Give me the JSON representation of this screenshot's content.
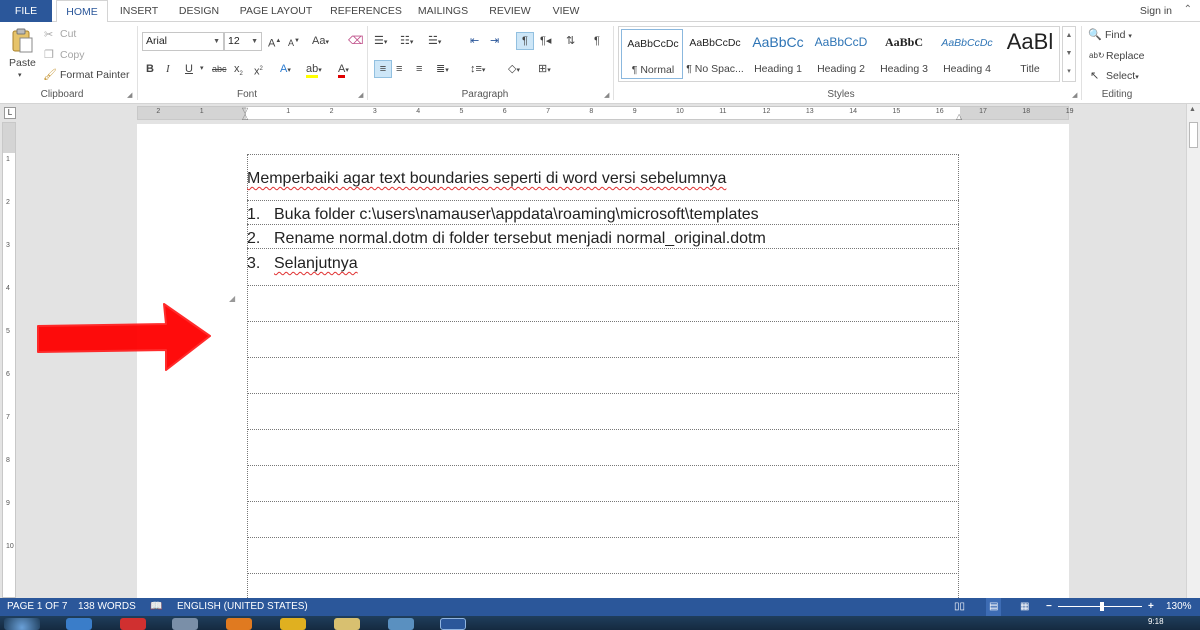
{
  "tabs": [
    "FILE",
    "HOME",
    "INSERT",
    "DESIGN",
    "PAGE LAYOUT",
    "REFERENCES",
    "MAILINGS",
    "REVIEW",
    "VIEW"
  ],
  "active_tab": "HOME",
  "signin": "Sign in",
  "clipboard": {
    "paste": "Paste",
    "cut": "Cut",
    "copy": "Copy",
    "format_painter": "Format Painter",
    "label": "Clipboard"
  },
  "font": {
    "name": "Arial",
    "size": "12",
    "case_label": "Aa",
    "label": "Font"
  },
  "paragraph": {
    "label": "Paragraph"
  },
  "styles": {
    "label": "Styles",
    "items": [
      {
        "preview": "AaBbCcDc",
        "name": "¶ Normal"
      },
      {
        "preview": "AaBbCcDc",
        "name": "¶ No Spac..."
      },
      {
        "preview": "AaBbCc",
        "name": "Heading 1"
      },
      {
        "preview": "AaBbCcD",
        "name": "Heading 2"
      },
      {
        "preview": "AaBbC",
        "name": "Heading 3"
      },
      {
        "preview": "AaBbCcDc",
        "name": "Heading 4"
      },
      {
        "preview": "AaBl",
        "name": "Title"
      }
    ]
  },
  "editing": {
    "find": "Find",
    "replace": "Replace",
    "select": "Select",
    "label": "Editing"
  },
  "ruler": {
    "h_ticks": [
      "2",
      "1",
      "1",
      "2",
      "3",
      "4",
      "5",
      "6",
      "7",
      "8",
      "9",
      "10",
      "11",
      "12",
      "13",
      "14",
      "15",
      "16",
      "17",
      "18",
      "19"
    ],
    "v_ticks": [
      "1",
      "2",
      "3",
      "4",
      "5",
      "6",
      "7",
      "8",
      "9",
      "10"
    ]
  },
  "document": {
    "heading": "Memperbaiki agar text boundaries seperti di word versi sebelumnya",
    "list": [
      {
        "num": "1.",
        "text": "Buka folder c:\\users\\namauser\\appdata\\roaming\\microsoft\\templates"
      },
      {
        "num": "2.",
        "text": "Rename normal.dotm di folder tersebut menjadi normal_original.dotm"
      },
      {
        "num": "3.",
        "text": "Selanjutnya"
      }
    ]
  },
  "status": {
    "page": "PAGE 1 OF 7",
    "words": "138 WORDS",
    "language": "ENGLISH (UNITED STATES)",
    "zoom": "130%",
    "zoom_minus": "−",
    "zoom_plus": "+"
  },
  "taskbar": {
    "clock": "9:18"
  },
  "colors": {
    "accent": "#2b579a",
    "arrow": "#ff0000",
    "spell_squiggle": "#e03030"
  }
}
